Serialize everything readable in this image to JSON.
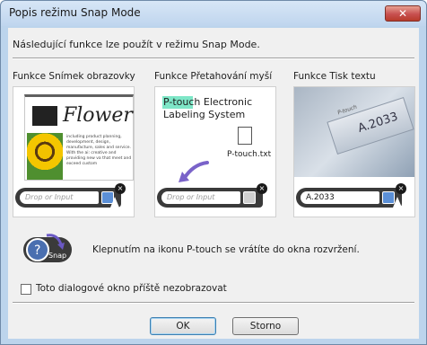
{
  "window": {
    "title": "Popis režimu Snap Mode",
    "close_glyph": "✕"
  },
  "intro": "Následující funkce lze použít v režimu Snap Mode.",
  "features": [
    {
      "title": "Funkce Snímek obrazovky",
      "image_word": "Flower",
      "image_text": "including product planning, development, design, manufacture, sales and service. With the ai: creative and providing new va that meet and exceed custom",
      "drop_placeholder": "Drop or Input"
    },
    {
      "title": "Funkce Přetahování myší",
      "line1_highlight": "P-touch",
      "line1_rest": " Electronic",
      "line2": "Labeling System",
      "file_name": "P-touch.txt",
      "drop_placeholder": "Drop or Input"
    },
    {
      "title": "Funkce Tisk textu",
      "tape_text": "A.2033",
      "tape_small": "P-touch",
      "drop_value": "A.2033"
    }
  ],
  "snap_icon_label": "Snap",
  "snap_description": "Klepnutím na ikonu P-touch se vrátíte do okna rozvržení.",
  "checkbox": {
    "label": "Toto dialogové okno příště nezobrazovat",
    "checked": false
  },
  "buttons": {
    "ok": "OK",
    "cancel": "Storno"
  },
  "colors": {
    "accent": "#5b8fd6",
    "highlight": "#7ee6c7",
    "close": "#c75050"
  },
  "icons": [
    "close-icon",
    "insert-icon",
    "file-icon",
    "drag-arrow-icon",
    "snap-mode-icon",
    "mouse-cursor-icon"
  ]
}
